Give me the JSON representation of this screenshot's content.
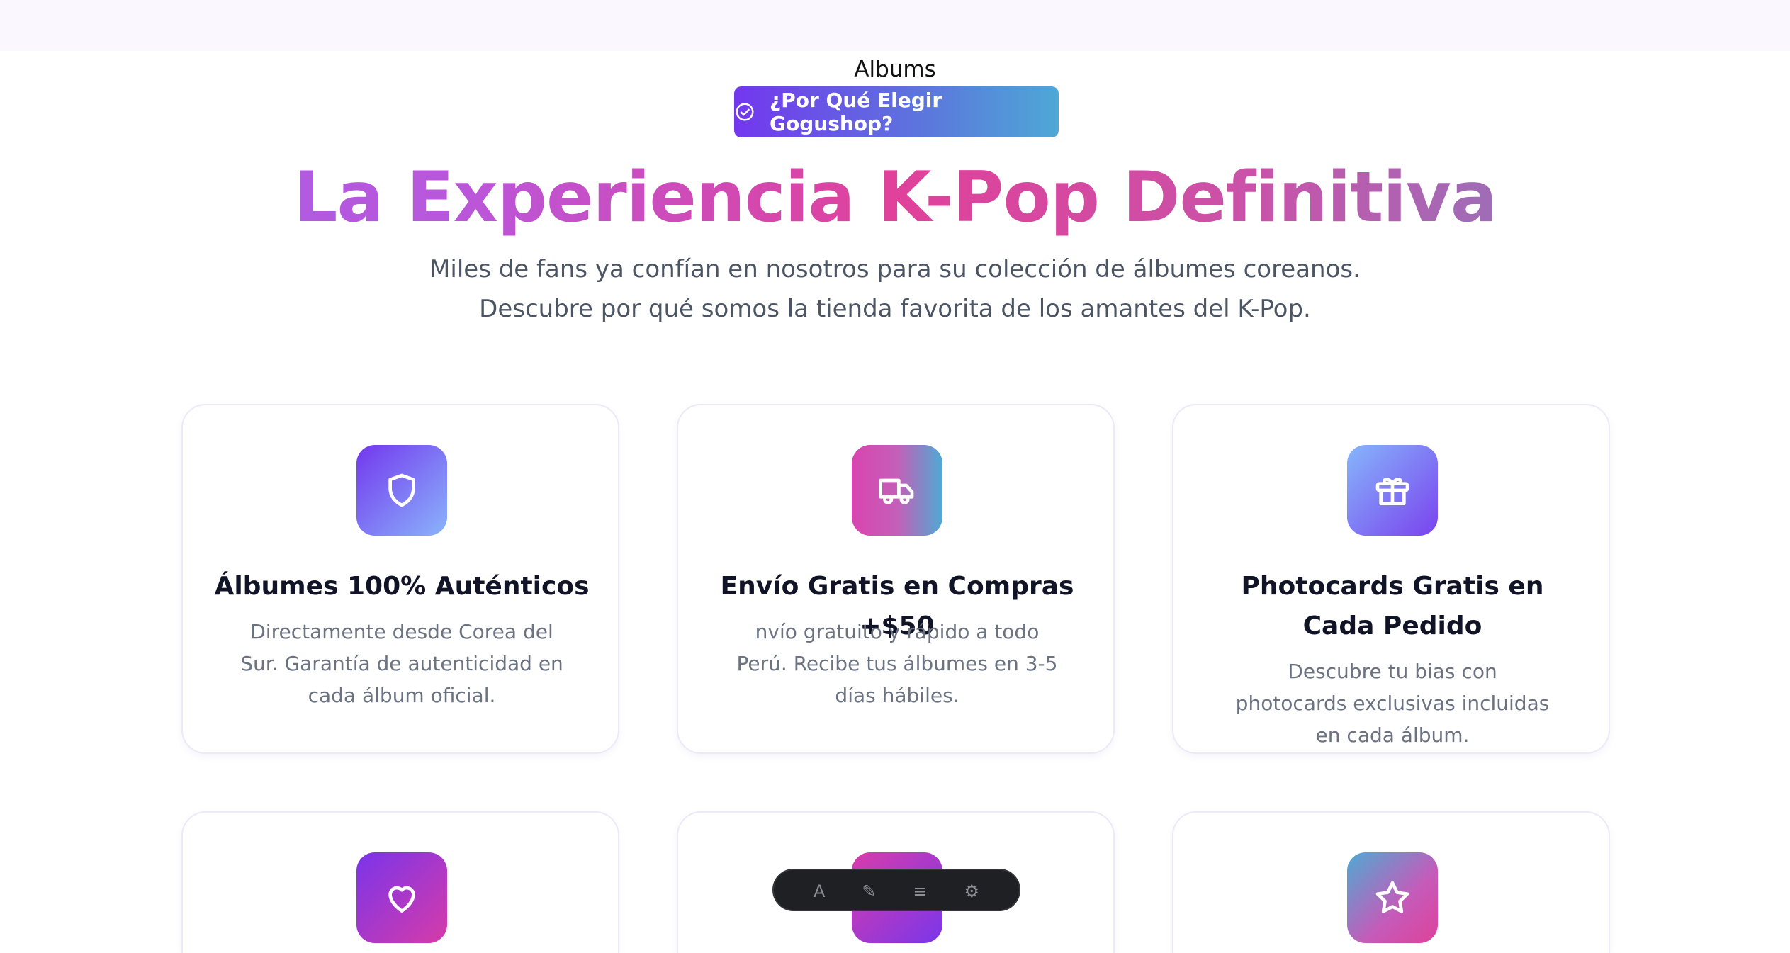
{
  "page": {
    "breadcrumb": "Albums",
    "badge_label": "¿Por Qué Elegir Gogushop?",
    "hero_title": "La Experiencia K-Pop Definitiva",
    "hero_subtitle_line1": "Miles de fans ya confían en nosotros para su colección de álbumes coreanos.",
    "hero_subtitle_line2": "Descubre por qué somos la tienda favorita de los amantes del K-Pop."
  },
  "features": [
    {
      "icon": "shield-icon",
      "title": "Álbumes 100% Auténticos",
      "description": "Directamente desde Corea del Sur. Garantía de autenticidad en cada álbum oficial."
    },
    {
      "icon": "truck-icon",
      "title": "Envío Gratis en Compras +$50",
      "description": "nvío gratuito y rápido a todo Perú. Recibe tus álbumes en 3-5 días hábiles."
    },
    {
      "icon": "gift-icon",
      "title": "Photocards Gratis en Cada Pedido",
      "description": "Descubre tu bias con photocards exclusivas incluidas en cada álbum."
    },
    {
      "icon": "heart-icon"
    },
    {
      "icon": "feature-icon"
    },
    {
      "icon": "star-icon"
    }
  ],
  "colors": {
    "badge_start": "#7337ee",
    "badge_end": "#4ea8d6",
    "title_gradient": [
      "#a35fe8",
      "#e0419a",
      "#6a8ec9"
    ],
    "card_border": "#ece9f8",
    "heading_text": "#101426",
    "body_text": "#6b7280"
  }
}
